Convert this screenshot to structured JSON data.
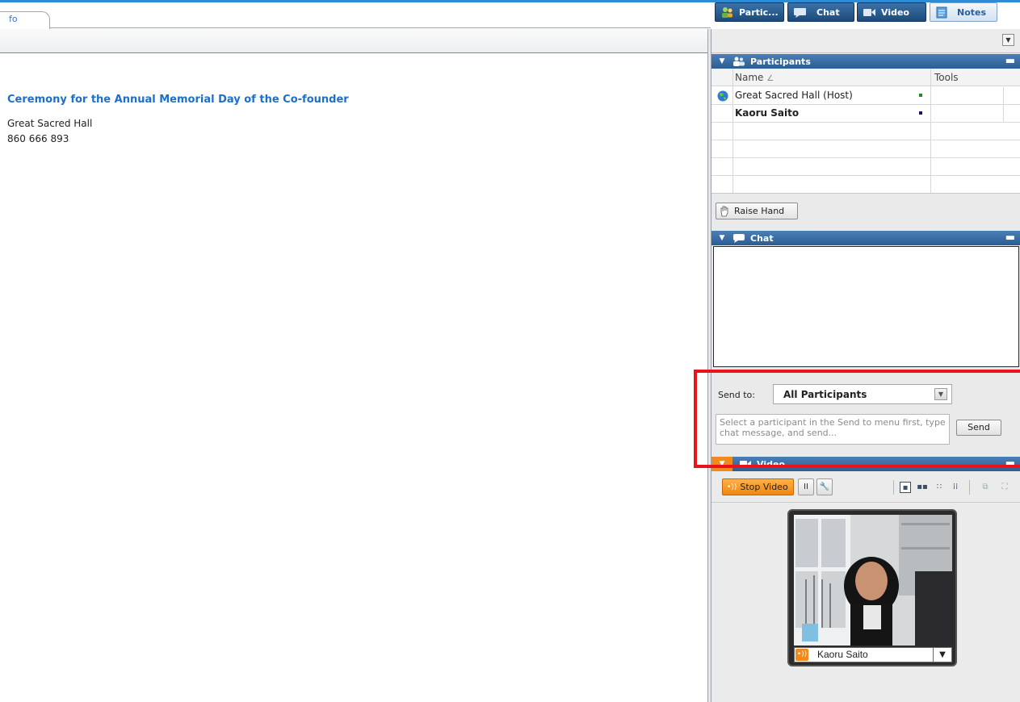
{
  "tab": {
    "label": "fo"
  },
  "meeting": {
    "title": "Ceremony for the Annual Memorial Day of the Co-founder",
    "host": "Great Sacred Hall",
    "number": "860 666 893"
  },
  "toolbar": {
    "participants_label": "Partic...",
    "chat_label": "Chat",
    "video_label": "Video",
    "notes_label": "Notes"
  },
  "participants": {
    "header": "Participants",
    "col_name": "Name",
    "col_tools": "Tools",
    "rows": [
      {
        "name": "Great Sacred Hall (Host)",
        "dot_color": "#1a8f1a"
      },
      {
        "name": "Kaoru Saito",
        "dot_color": "#12127a"
      }
    ],
    "raise_hand_label": "Raise Hand"
  },
  "chat": {
    "header": "Chat",
    "send_to_label": "Send to:",
    "send_to_value": "All Participants",
    "input_placeholder": "Select a participant in the Send to menu first, type chat message, and send...",
    "send_label": "Send"
  },
  "video": {
    "header": "Video",
    "stop_label": "Stop Video",
    "participant_name": "Kaoru Saito"
  },
  "colors": {
    "accent": "#2e8bd6",
    "header_blue": "#2b5d93",
    "highlight_red": "#e8141a",
    "video_orange": "#f08a1c"
  }
}
